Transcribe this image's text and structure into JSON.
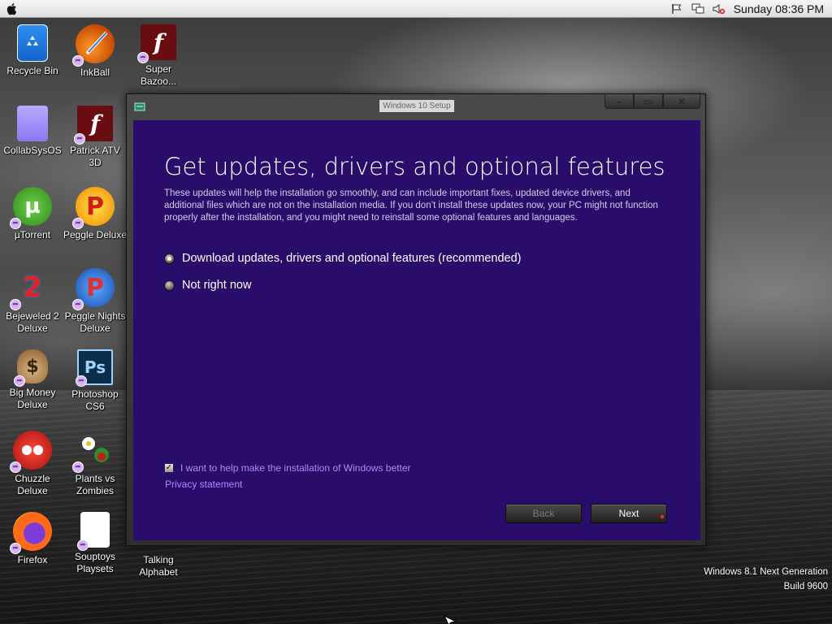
{
  "menubar": {
    "clock": "Sunday 08:36 PM"
  },
  "desktop": {
    "icons": [
      {
        "label": "Recycle Bin",
        "icon": "recycle-bin-icon"
      },
      {
        "label": "InkBall",
        "icon": "inkball-icon"
      },
      {
        "label": "Super\nBazoo...",
        "icon": "flash-icon"
      },
      {
        "label": "CollabSysOS",
        "icon": "folder-icon"
      },
      {
        "label": "Patrick ATV\n3D",
        "icon": "flash-icon"
      },
      {
        "label": "µTorrent",
        "icon": "utorrent-icon"
      },
      {
        "label": "Peggle Deluxe",
        "icon": "peggle-icon"
      },
      {
        "label": "Bejeweled 2\nDeluxe",
        "icon": "bejeweled-icon"
      },
      {
        "label": "Peggle Nights\nDeluxe",
        "icon": "peggle-nights-icon"
      },
      {
        "label": "Big Money\nDeluxe",
        "icon": "money-bag-icon"
      },
      {
        "label": "Photoshop\nCS6",
        "icon": "photoshop-icon"
      },
      {
        "label": "Chuzzle\nDeluxe",
        "icon": "chuzzle-icon"
      },
      {
        "label": "Plants vs\nZombies",
        "icon": "plants-icon"
      },
      {
        "label": "Firefox",
        "icon": "firefox-icon"
      },
      {
        "label": "Souptoys\nPlaysets",
        "icon": "blank-app-icon"
      },
      {
        "label": "Talking\nAlphabet",
        "icon": "app-icon"
      }
    ]
  },
  "setup": {
    "window_title": "Windows 10 Setup",
    "heading": "Get updates, drivers and optional features",
    "description": "These updates will help the installation go smoothly, and can include important fixes, updated device drivers, and additional files which are not on the installation media. If you don’t install these updates now, your PC might not function properly after the installation, and you might need to reinstall some optional features and languages.",
    "options": [
      {
        "label": "Download updates, drivers and optional features (recommended)",
        "selected": true
      },
      {
        "label": "Not right now",
        "selected": false
      }
    ],
    "help_checkbox_label": "I want to help make the installation of Windows better",
    "help_checked": true,
    "privacy_link": "Privacy statement",
    "back_button": "Back",
    "next_button": "Next"
  },
  "watermark": {
    "line1": "Windows 8.1 Next Generation",
    "line2": "Build 9600"
  }
}
